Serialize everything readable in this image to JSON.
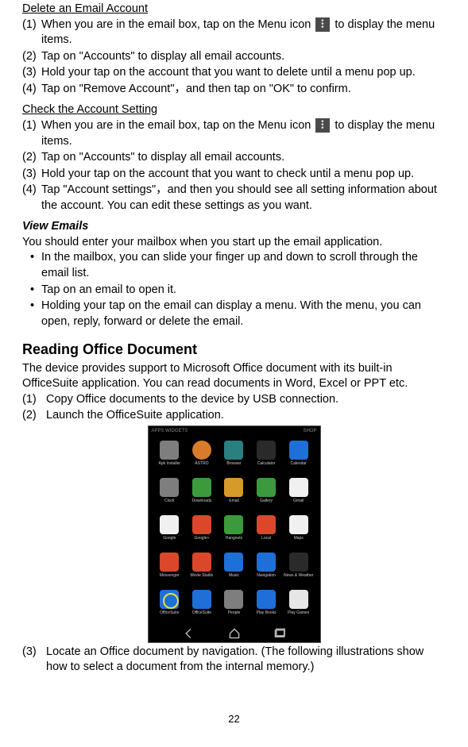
{
  "sec1": {
    "heading": "Delete an Email Account",
    "s1a": "(1)",
    "s1b_pre": "When you are in the email box, tap on the Menu icon ",
    "s1b_post": " to display the menu items.",
    "s2a": "(2)",
    "s2b": "Tap on \"Accounts\" to display all email accounts.",
    "s3a": "(3)",
    "s3b": "Hold your tap on the account that you want to delete until a menu pop up.",
    "s4a": "(4)",
    "s4b": "Tap on \"Remove Account\"，and then tap on \"OK\" to confirm."
  },
  "sec2": {
    "heading": "Check the Account Setting",
    "s1a": "(1)",
    "s1b_pre": "When you are in the email box, tap on the Menu icon ",
    "s1b_post": " to display the menu items.",
    "s2a": "(2)",
    "s2b": "Tap on \"Accounts\" to display all email accounts.",
    "s3a": "(3)",
    "s3b": "Hold your tap on the account that you want to check until a menu pop up.",
    "s4a": "(4)",
    "s4b": "Tap \"Account settings\"，and then you should see all setting information about the account. You can edit these settings as you want."
  },
  "sec3": {
    "heading": "View Emails",
    "intro": "You should enter your mailbox when you start up the email application.",
    "bulletMark": "•",
    "b1": "In the mailbox, you can slide your finger up and down to scroll through the email list.",
    "b2": "Tap on an email to open it.",
    "b3": "Holding your tap on the email can display a menu. With the menu, you can open, reply, forward or delete the email."
  },
  "sec4": {
    "heading": "Reading Office Document",
    "p1": "The device provides support to Microsoft Office document with its built-in OfficeSuite application. You can read documents in Word, Excel or PPT etc.",
    "s1a": "(1)",
    "s1b": "Copy Office documents to the device by USB connection.",
    "s2a": "(2)",
    "s2b": "Launch the OfficeSuite application.",
    "s3a": "(3)",
    "s3b": "Locate an Office document by navigation. (The following illustrations show how to select a document from the internal memory.)"
  },
  "statusbar": {
    "left": "APPS   WIDGETS",
    "right": "SHOP"
  },
  "apps": [
    {
      "label": "Apk Installer",
      "cls": "c-gray"
    },
    {
      "label": "ASTRO",
      "cls": "c-orangeCircle"
    },
    {
      "label": "Browser",
      "cls": "c-teal"
    },
    {
      "label": "Calculator",
      "cls": "c-dark"
    },
    {
      "label": "Calendar",
      "cls": "c-blue"
    },
    {
      "label": "Clock",
      "cls": "c-gray"
    },
    {
      "label": "Downloads",
      "cls": "c-green"
    },
    {
      "label": "Email",
      "cls": "c-mail"
    },
    {
      "label": "Gallery",
      "cls": "c-green"
    },
    {
      "label": "Gmail",
      "cls": "c-white"
    },
    {
      "label": "Google",
      "cls": "c-white"
    },
    {
      "label": "Google+",
      "cls": "c-red"
    },
    {
      "label": "Hangouts",
      "cls": "c-green"
    },
    {
      "label": "Local",
      "cls": "c-red"
    },
    {
      "label": "Maps",
      "cls": "c-white"
    },
    {
      "label": "Messenger",
      "cls": "c-red"
    },
    {
      "label": "Movie Studio",
      "cls": "c-red"
    },
    {
      "label": "Music",
      "cls": "c-blue"
    },
    {
      "label": "Navigation",
      "cls": "c-blue"
    },
    {
      "label": "News & Weather",
      "cls": "c-dark"
    },
    {
      "label": "OfficeSuite",
      "cls": "c-blue c-highlighted"
    },
    {
      "label": "OfficeSuite",
      "cls": "c-blue"
    },
    {
      "label": "People",
      "cls": "c-gray"
    },
    {
      "label": "Play Books",
      "cls": "c-blue"
    },
    {
      "label": "Play Games",
      "cls": "c-play"
    }
  ],
  "pageNumber": "22"
}
